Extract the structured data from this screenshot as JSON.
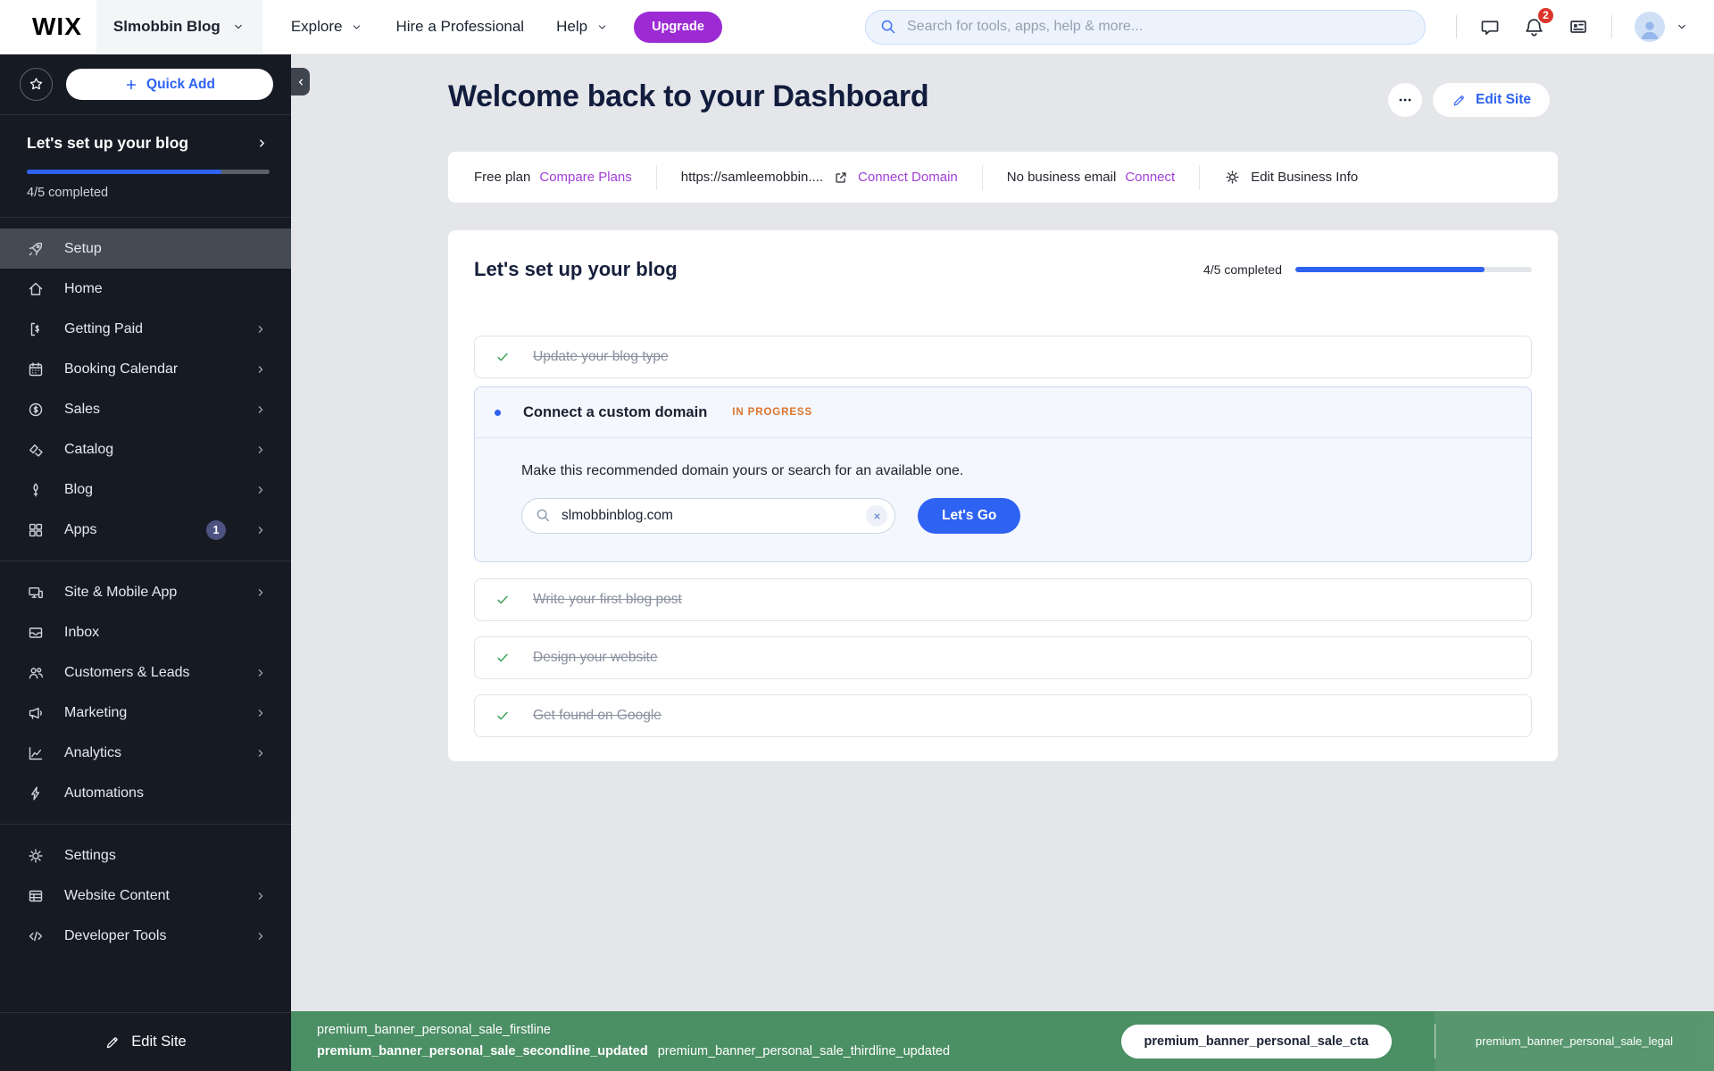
{
  "topbar": {
    "logo": "WIX",
    "site_menu": "Slmobbin Blog",
    "nav": [
      "Explore",
      "Hire a Professional",
      "Help"
    ],
    "upgrade_label": "Upgrade",
    "search_placeholder": "Search for tools, apps, help & more...",
    "notification_count": "2"
  },
  "sidebar": {
    "quick_add_label": "Quick Add",
    "setup": {
      "title": "Let's set up your blog",
      "completed_label": "4/5 completed",
      "percent": 80
    },
    "menu": [
      {
        "label": "Setup",
        "icon": "rocket-icon",
        "active": true
      },
      {
        "label": "Home",
        "icon": "home-icon"
      },
      {
        "label": "Getting Paid",
        "icon": "invoice-icon",
        "chevron": true
      },
      {
        "label": "Booking Calendar",
        "icon": "calendar-icon",
        "chevron": true
      },
      {
        "label": "Sales",
        "icon": "dollar-circle-icon",
        "chevron": true
      },
      {
        "label": "Catalog",
        "icon": "tags-icon",
        "chevron": true
      },
      {
        "label": "Blog",
        "icon": "quill-icon",
        "chevron": true
      },
      {
        "label": "Apps",
        "icon": "apps-grid-icon",
        "chevron": true,
        "badge": "1"
      },
      {
        "label": "Site & Mobile App",
        "icon": "devices-icon",
        "chevron": true
      },
      {
        "label": "Inbox",
        "icon": "inbox-icon"
      },
      {
        "label": "Customers & Leads",
        "icon": "people-icon",
        "chevron": true
      },
      {
        "label": "Marketing",
        "icon": "megaphone-icon",
        "chevron": true
      },
      {
        "label": "Analytics",
        "icon": "chart-icon",
        "chevron": true
      },
      {
        "label": "Automations",
        "icon": "bolt-icon"
      },
      {
        "label": "Settings",
        "icon": "gear-icon"
      },
      {
        "label": "Website Content",
        "icon": "content-icon",
        "chevron": true
      },
      {
        "label": "Developer Tools",
        "icon": "code-icon",
        "chevron": true
      }
    ],
    "edit_site_label": "Edit Site"
  },
  "header": {
    "title": "Welcome back to your Dashboard",
    "edit_site_label": "Edit Site"
  },
  "infobar": {
    "plan_label": "Free plan",
    "compare_plans": "Compare Plans",
    "site_url": "https://samleemobbin....",
    "connect_domain": "Connect Domain",
    "no_email_label": "No business email",
    "connect": "Connect",
    "edit_business_info": "Edit Business Info"
  },
  "setup_card": {
    "title": "Let's set up your blog",
    "progress_label": "4/5 completed",
    "percent": 80,
    "tasks": [
      {
        "label": "Update your blog type",
        "state": "done"
      },
      {
        "label": "Connect a custom domain",
        "state": "in_progress",
        "status_label": "IN PROGRESS",
        "description": "Make this recommended domain yours or search for an available one.",
        "domain_value": "slmobbinblog.com",
        "cta_label": "Let's Go"
      },
      {
        "label": "Write your first blog post",
        "state": "done"
      },
      {
        "label": "Design your website",
        "state": "done"
      },
      {
        "label": "Get found on Google",
        "state": "done"
      }
    ]
  },
  "banner": {
    "firstline": "premium_banner_personal_sale_firstline",
    "secondline": "premium_banner_personal_sale_secondline_updated",
    "thirdline": "premium_banner_personal_sale_thirdline_updated",
    "cta": "premium_banner_personal_sale_cta",
    "legal": "premium_banner_personal_sale_legal"
  },
  "colors": {
    "accent_blue": "#2e62f2",
    "link_purple": "#a03fd9",
    "upgrade_purple": "#9c2bd4",
    "banner_green": "#4b8f64",
    "badge_red": "#dd342c",
    "success_green": "#3fa45c",
    "warning_orange": "#dc742e",
    "sidebar_bg": "#161a23"
  }
}
